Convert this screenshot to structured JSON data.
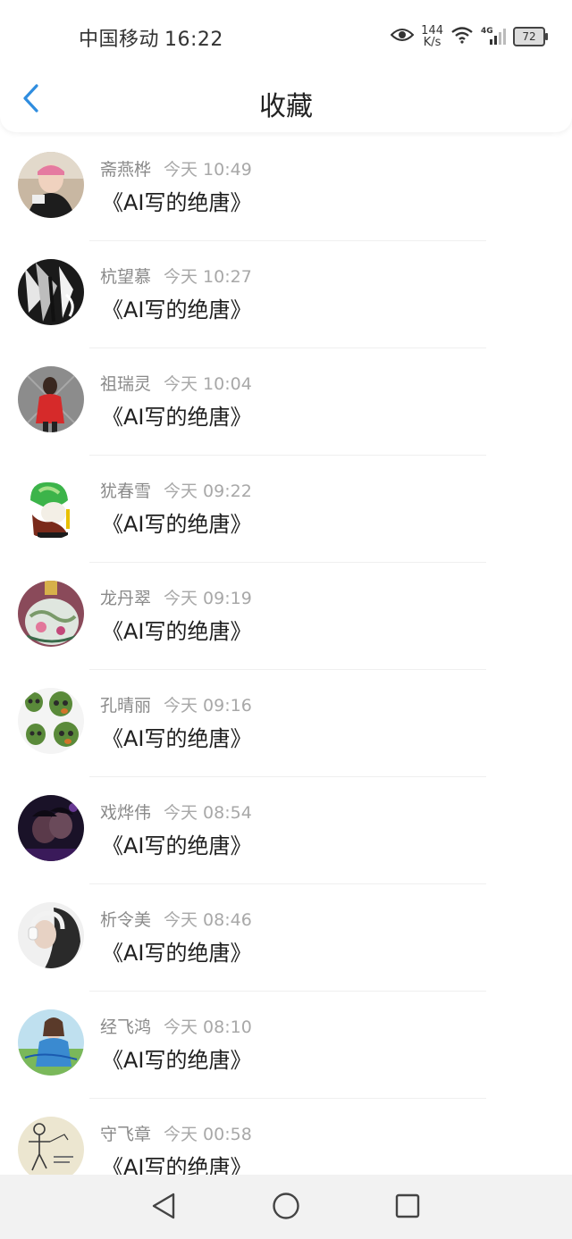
{
  "status_bar": {
    "carrier": "中国移动",
    "time": "16:22",
    "speed_value": "144",
    "speed_unit": "K/s",
    "network": "4G",
    "battery": "72"
  },
  "header": {
    "title": "收藏",
    "accent_color": "#2f8ddf"
  },
  "favorites": [
    {
      "name": "斋燕桦",
      "time": "今天 10:49",
      "title": "《AI写的绝唐》",
      "avatar": "avatar-girl-pink-cap"
    },
    {
      "name": "杭望慕",
      "time": "今天 10:27",
      "title": "《AI写的绝唐》",
      "avatar": "avatar-tiger"
    },
    {
      "name": "祖瑞灵",
      "time": "今天 10:04",
      "title": "《AI写的绝唐》",
      "avatar": "avatar-girl-red-dress"
    },
    {
      "name": "犹春雪",
      "time": "今天 09:22",
      "title": "《AI写的绝唐》",
      "avatar": "avatar-jade-cabbage"
    },
    {
      "name": "龙丹翠",
      "time": "今天 09:19",
      "title": "《AI写的绝唐》",
      "avatar": "avatar-porcelain-bottle"
    },
    {
      "name": "孔晴丽",
      "time": "今天 09:16",
      "title": "《AI写的绝唐》",
      "avatar": "avatar-jade-skulls"
    },
    {
      "name": "戏烨伟",
      "time": "今天 08:54",
      "title": "《AI写的绝唐》",
      "avatar": "avatar-dark-couple"
    },
    {
      "name": "析令美",
      "time": "今天 08:46",
      "title": "《AI写的绝唐》",
      "avatar": "avatar-girl-headphones"
    },
    {
      "name": "经飞鸿",
      "time": "今天 08:10",
      "title": "《AI写的绝唐》",
      "avatar": "avatar-girl-outdoor"
    },
    {
      "name": "守飞章",
      "time": "今天 00:58",
      "title": "《AI写的绝唐》",
      "avatar": "avatar-skeleton-sketch"
    }
  ]
}
